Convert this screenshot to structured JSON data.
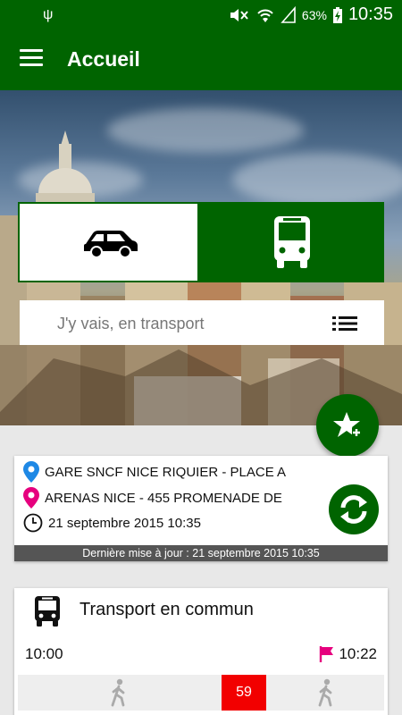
{
  "status_bar": {
    "battery": "63%",
    "time": "10:35"
  },
  "app_bar": {
    "title": "Accueil"
  },
  "mode_selector": {
    "car_icon": "car-icon",
    "bus_icon": "bus-icon"
  },
  "search": {
    "placeholder": "J'y vais, en transport"
  },
  "trip": {
    "from": "GARE SNCF NICE RIQUIER - PLACE A",
    "to": "ARENAS NICE - 455 PROMENADE DE",
    "date": "21 septembre 2015 10:35",
    "last_update": "Dernière mise à jour : 21 septembre 2015 10:35"
  },
  "transport": {
    "title": "Transport en commun",
    "departure": "10:00",
    "arrival": "10:22",
    "line": "59"
  },
  "colors": {
    "primary": "#006400",
    "pin_from": "#1e88e5",
    "pin_to": "#e6007e",
    "line_badge": "#f20000"
  }
}
